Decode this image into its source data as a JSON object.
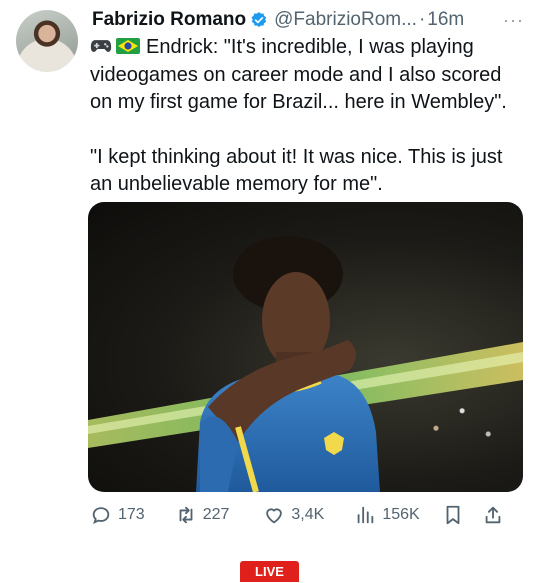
{
  "author": {
    "name": "Fabrizio Romano",
    "handle": "@FabrizioRom...",
    "separator": "·",
    "time": "16m",
    "more_label": "···"
  },
  "tweet": {
    "line1": "Endrick: \"It's incredible, I was playing videogames on career mode and I also scored on my first game for Brazil... here in Wembley\".",
    "line2": "\"I kept thinking about it! It was nice. This is just an unbelievable memory for me\"."
  },
  "media": {
    "alt": "Player in a yellow and blue Brazil shirt celebrating with his arm raised across his face"
  },
  "actions": {
    "replies": "173",
    "retweets": "227",
    "likes": "3,4K",
    "views": "156K"
  },
  "footer": {
    "live_badge": "LIVE"
  },
  "colors": {
    "verified": "#1d9bf0",
    "muted": "#536471",
    "live": "#e0201b"
  },
  "icons": [
    "controller-icon",
    "brazil-flag-icon",
    "verified-icon",
    "reply-icon",
    "retweet-icon",
    "like-icon",
    "views-icon",
    "bookmark-icon",
    "share-icon"
  ]
}
